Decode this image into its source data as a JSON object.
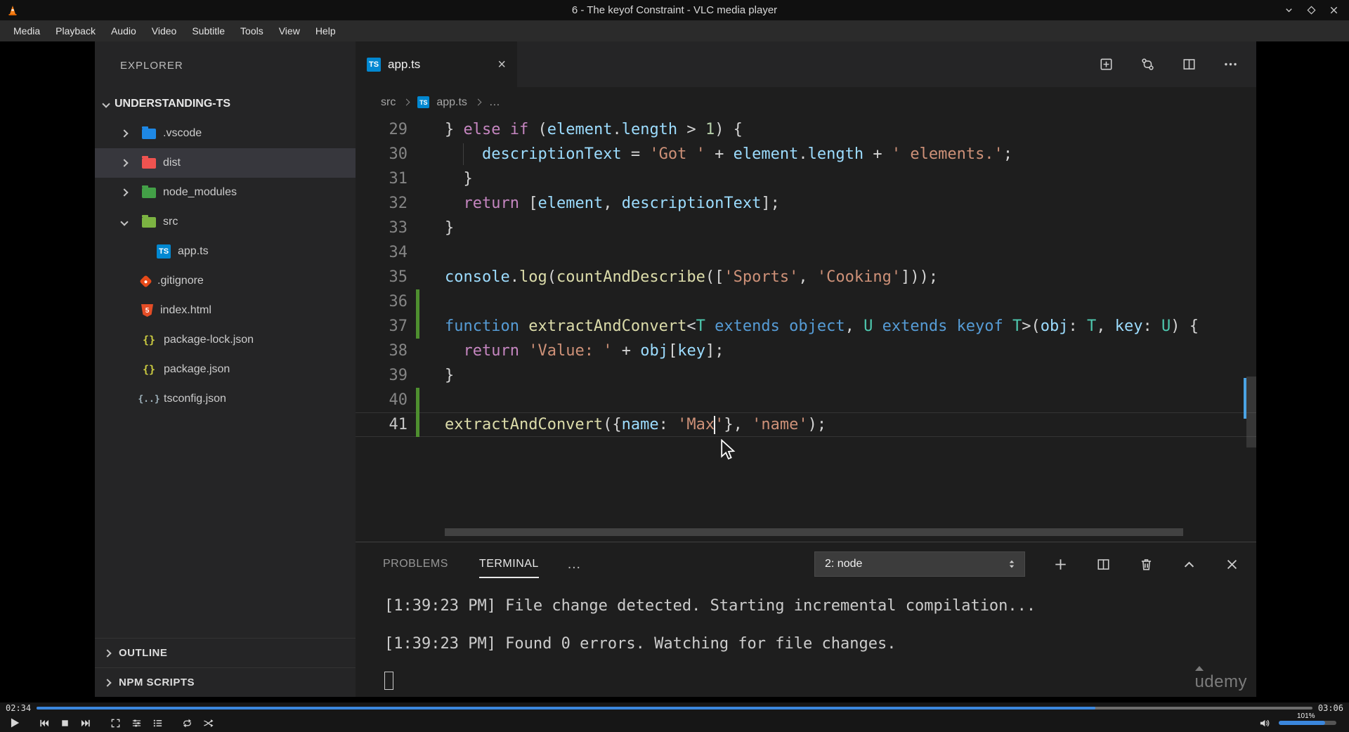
{
  "colors": {
    "ctrl": "#C586C0",
    "kw": "#569CD6",
    "type": "#4EC9B0",
    "fn": "#DCDCAA",
    "var": "#9CDCFE",
    "str": "#CE9178",
    "num": "#B5CEA8",
    "fg": "#D4D4D4",
    "gutter_added": "#4e8f2f",
    "progress": "#3b87dd",
    "selection_bg": "#37373d"
  },
  "icon_glyphs": {
    "ts": "TS",
    "html": "5",
    "json": "{}",
    "json2": "{..}"
  },
  "vlc": {
    "title": "6 - The keyof Constraint - VLC media player",
    "menu": [
      "Media",
      "Playback",
      "Audio",
      "Video",
      "Subtitle",
      "Tools",
      "View",
      "Help"
    ],
    "window_controls": [
      "minimize",
      "maximize",
      "close"
    ],
    "time_elapsed": "02:34",
    "time_total": "03:06",
    "progress_pct": 83,
    "volume_pct": 80,
    "volume_label": "101%",
    "controls": [
      "play",
      "previous",
      "stop",
      "next",
      "fullscreen",
      "extended-settings",
      "show-playlist",
      "loop",
      "random"
    ]
  },
  "vscode": {
    "explorer": {
      "header": "EXPLORER",
      "root": "UNDERSTANDING-TS",
      "items": [
        {
          "label": ".vscode",
          "kind": "folder",
          "color": "#1e88e5",
          "chevron": "right",
          "indent": 1
        },
        {
          "label": "dist",
          "kind": "folder",
          "color": "#ef5350",
          "chevron": "right",
          "indent": 1,
          "selected": true
        },
        {
          "label": "node_modules",
          "kind": "folder",
          "color": "#43a047",
          "chevron": "right",
          "indent": 1
        },
        {
          "label": "src",
          "kind": "folder",
          "color": "#7cb342",
          "chevron": "down",
          "indent": 1
        },
        {
          "label": "app.ts",
          "kind": "ts",
          "indent": 2
        },
        {
          "label": ".gitignore",
          "kind": "git",
          "indent": 1
        },
        {
          "label": "index.html",
          "kind": "html",
          "indent": 1
        },
        {
          "label": "package-lock.json",
          "kind": "json",
          "indent": 1
        },
        {
          "label": "package.json",
          "kind": "json",
          "indent": 1
        },
        {
          "label": "tsconfig.json",
          "kind": "json2",
          "indent": 1
        }
      ],
      "sections": [
        "OUTLINE",
        "NPM SCRIPTS"
      ]
    },
    "editor": {
      "tab": "app.ts",
      "tab_actions": [
        "open-changes",
        "git-compare",
        "split-editor",
        "more-actions"
      ],
      "breadcrumb": [
        "src",
        "app.ts",
        "…"
      ],
      "code": {
        "lines": [
          {
            "n": 29,
            "tokens": [
              {
                "t": "} ",
                "c": "fg"
              },
              {
                "t": "else",
                "c": "ctrl"
              },
              {
                "t": " ",
                "c": "fg"
              },
              {
                "t": "if",
                "c": "ctrl"
              },
              {
                "t": " (",
                "c": "fg"
              },
              {
                "t": "element",
                "c": "var"
              },
              {
                "t": ".",
                "c": "fg"
              },
              {
                "t": "length",
                "c": "var"
              },
              {
                "t": " > ",
                "c": "fg"
              },
              {
                "t": "1",
                "c": "num"
              },
              {
                "t": ") {",
                "c": "fg"
              }
            ]
          },
          {
            "n": 30,
            "guide": true,
            "tokens": [
              {
                "t": "    ",
                "c": "fg"
              },
              {
                "t": "descriptionText",
                "c": "var"
              },
              {
                "t": " = ",
                "c": "fg"
              },
              {
                "t": "'Got '",
                "c": "str"
              },
              {
                "t": " + ",
                "c": "fg"
              },
              {
                "t": "element",
                "c": "var"
              },
              {
                "t": ".",
                "c": "fg"
              },
              {
                "t": "length",
                "c": "var"
              },
              {
                "t": " + ",
                "c": "fg"
              },
              {
                "t": "' elements.'",
                "c": "str"
              },
              {
                "t": ";",
                "c": "fg"
              }
            ]
          },
          {
            "n": 31,
            "tokens": [
              {
                "t": "  }",
                "c": "fg"
              }
            ]
          },
          {
            "n": 32,
            "tokens": [
              {
                "t": "  ",
                "c": "fg"
              },
              {
                "t": "return",
                "c": "ctrl"
              },
              {
                "t": " [",
                "c": "fg"
              },
              {
                "t": "element",
                "c": "var"
              },
              {
                "t": ", ",
                "c": "fg"
              },
              {
                "t": "descriptionText",
                "c": "var"
              },
              {
                "t": "];",
                "c": "fg"
              }
            ]
          },
          {
            "n": 33,
            "tokens": [
              {
                "t": "}",
                "c": "fg"
              }
            ]
          },
          {
            "n": 34,
            "tokens": []
          },
          {
            "n": 35,
            "tokens": [
              {
                "t": "console",
                "c": "var"
              },
              {
                "t": ".",
                "c": "fg"
              },
              {
                "t": "log",
                "c": "fn"
              },
              {
                "t": "(",
                "c": "fg"
              },
              {
                "t": "countAndDescribe",
                "c": "fn"
              },
              {
                "t": "([",
                "c": "fg"
              },
              {
                "t": "'Sports'",
                "c": "str"
              },
              {
                "t": ", ",
                "c": "fg"
              },
              {
                "t": "'Cooking'",
                "c": "str"
              },
              {
                "t": "]));",
                "c": "fg"
              }
            ]
          },
          {
            "n": 36,
            "added": true,
            "tokens": []
          },
          {
            "n": 37,
            "added": true,
            "tokens": [
              {
                "t": "function",
                "c": "kw"
              },
              {
                "t": " ",
                "c": "fg"
              },
              {
                "t": "extractAndConvert",
                "c": "fn"
              },
              {
                "t": "<",
                "c": "fg"
              },
              {
                "t": "T",
                "c": "type"
              },
              {
                "t": " ",
                "c": "fg"
              },
              {
                "t": "extends",
                "c": "kw"
              },
              {
                "t": " ",
                "c": "fg"
              },
              {
                "t": "object",
                "c": "kw"
              },
              {
                "t": ", ",
                "c": "fg"
              },
              {
                "t": "U",
                "c": "type"
              },
              {
                "t": " ",
                "c": "fg"
              },
              {
                "t": "extends",
                "c": "kw"
              },
              {
                "t": " ",
                "c": "fg"
              },
              {
                "t": "keyof",
                "c": "kw"
              },
              {
                "t": " ",
                "c": "fg"
              },
              {
                "t": "T",
                "c": "type"
              },
              {
                "t": ">(",
                "c": "fg"
              },
              {
                "t": "obj",
                "c": "var"
              },
              {
                "t": ": ",
                "c": "fg"
              },
              {
                "t": "T",
                "c": "type"
              },
              {
                "t": ", ",
                "c": "fg"
              },
              {
                "t": "key",
                "c": "var"
              },
              {
                "t": ": ",
                "c": "fg"
              },
              {
                "t": "U",
                "c": "type"
              },
              {
                "t": ") {",
                "c": "fg"
              }
            ]
          },
          {
            "n": 38,
            "tokens": [
              {
                "t": "  ",
                "c": "fg"
              },
              {
                "t": "return",
                "c": "ctrl"
              },
              {
                "t": " ",
                "c": "fg"
              },
              {
                "t": "'Value: '",
                "c": "str"
              },
              {
                "t": " + ",
                "c": "fg"
              },
              {
                "t": "obj",
                "c": "var"
              },
              {
                "t": "[",
                "c": "fg"
              },
              {
                "t": "key",
                "c": "var"
              },
              {
                "t": "];",
                "c": "fg"
              }
            ]
          },
          {
            "n": 39,
            "tokens": [
              {
                "t": "}",
                "c": "fg"
              }
            ]
          },
          {
            "n": 40,
            "added": true,
            "tokens": []
          },
          {
            "n": 41,
            "added": true,
            "current": true,
            "tokens": [
              {
                "t": "extractAndConvert",
                "c": "fn"
              },
              {
                "t": "({",
                "c": "fg"
              },
              {
                "t": "name",
                "c": "var"
              },
              {
                "t": ": ",
                "c": "fg"
              },
              {
                "t": "'Max",
                "c": "str"
              },
              {
                "t": "",
                "c": "cursor"
              },
              {
                "t": "'",
                "c": "str"
              },
              {
                "t": "}, ",
                "c": "fg"
              },
              {
                "t": "'name'",
                "c": "str"
              },
              {
                "t": ");",
                "c": "fg"
              }
            ]
          }
        ]
      }
    },
    "panel": {
      "tabs": [
        {
          "label": "PROBLEMS",
          "active": false
        },
        {
          "label": "TERMINAL",
          "active": true
        }
      ],
      "overflow": "…",
      "dropdown": "2: node",
      "actions": [
        "new-terminal",
        "split-terminal",
        "kill-terminal",
        "maximize-panel",
        "close-panel"
      ],
      "terminal": [
        "[1:39:23 PM] File change detected. Starting incremental compilation...",
        "[1:39:23 PM] Found 0 errors. Watching for file changes."
      ]
    },
    "watermark": "udemy"
  }
}
